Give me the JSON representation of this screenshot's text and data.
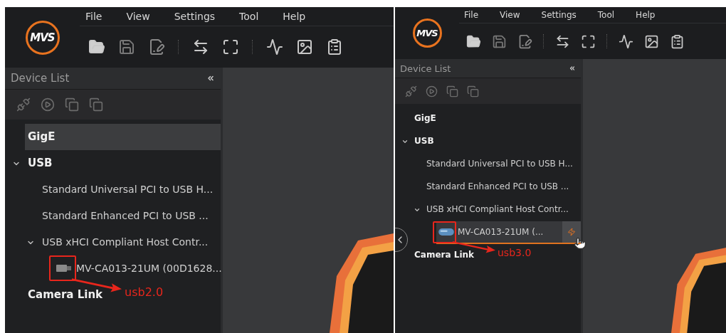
{
  "screens": [
    {
      "logo": "MVS",
      "menu": [
        "File",
        "View",
        "Settings",
        "Tool",
        "Help"
      ],
      "device_list": {
        "title": "Device List"
      },
      "tree": [
        {
          "label": "GigE",
          "selected": true
        },
        {
          "label": "USB",
          "selected": false,
          "expanded": true,
          "children": [
            {
              "label": "Standard Universal PCI to USB H...",
              "selected": false
            },
            {
              "label": "Standard Enhanced PCI to USB ...",
              "selected": false
            },
            {
              "label": "USB xHCI Compliant Host Contr...",
              "selected": false,
              "expanded": true,
              "children": [
                {
                  "label": "MV-CA013-21UM (00D1628...",
                  "selected": false,
                  "kind": "usb2",
                  "annotation": "usb2.0"
                }
              ]
            }
          ]
        },
        {
          "label": "Camera Link",
          "selected": false
        }
      ]
    },
    {
      "logo": "MVS",
      "menu": [
        "File",
        "View",
        "Settings",
        "Tool",
        "Help"
      ],
      "device_list": {
        "title": "Device List"
      },
      "tree": [
        {
          "label": "GigE",
          "selected": false
        },
        {
          "label": "USB",
          "selected": false,
          "expanded": true,
          "children": [
            {
              "label": "Standard Universal PCI to USB H...",
              "selected": false
            },
            {
              "label": "Standard Enhanced PCI to USB ...",
              "selected": false
            },
            {
              "label": "USB xHCI Compliant Host Contr...",
              "selected": false,
              "expanded": true,
              "children": [
                {
                  "label": "MV-CA013-21UM (...",
                  "selected": true,
                  "kind": "usb3",
                  "annotation": "usb3.0"
                }
              ]
            }
          ]
        },
        {
          "label": "Camera Link",
          "selected": false
        }
      ]
    }
  ]
}
